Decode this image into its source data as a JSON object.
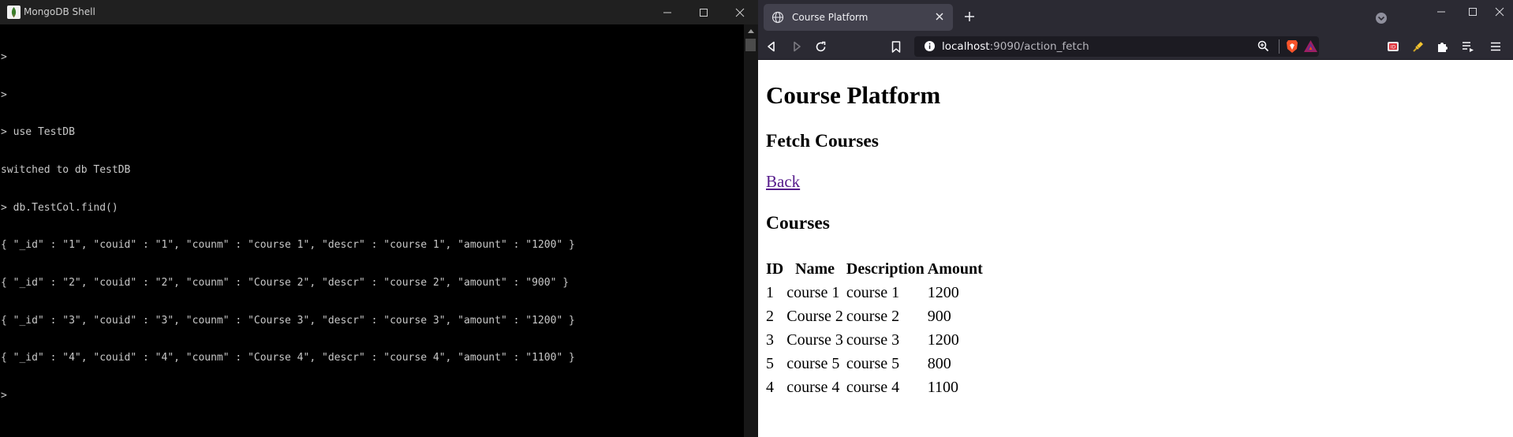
{
  "terminal": {
    "title": "MongoDB Shell",
    "lines": [
      ">",
      ">",
      "> use TestDB",
      "switched to db TestDB",
      "> db.TestCol.find()",
      "{ \"_id\" : \"1\", \"couid\" : \"1\", \"counm\" : \"course 1\", \"descr\" : \"course 1\", \"amount\" : \"1200\" }",
      "{ \"_id\" : \"2\", \"couid\" : \"2\", \"counm\" : \"Course 2\", \"descr\" : \"course 2\", \"amount\" : \"900\" }",
      "{ \"_id\" : \"3\", \"couid\" : \"3\", \"counm\" : \"Course 3\", \"descr\" : \"course 3\", \"amount\" : \"1200\" }",
      "{ \"_id\" : \"4\", \"couid\" : \"4\", \"counm\" : \"Course 4\", \"descr\" : \"course 4\", \"amount\" : \"1100\" }",
      ">"
    ]
  },
  "browser": {
    "tab": {
      "title": "Course Platform"
    },
    "url": {
      "host": "localhost",
      "rest": ":9090/action_fetch"
    }
  },
  "page": {
    "title": "Course Platform",
    "subtitle": "Fetch Courses",
    "back_link": "Back",
    "courses_heading": "Courses",
    "table": {
      "headers": [
        "ID",
        "Name",
        "Description",
        "Amount"
      ],
      "rows": [
        [
          "1",
          "course 1",
          "course 1",
          "1200"
        ],
        [
          "2",
          "Course 2",
          "course 2",
          "900"
        ],
        [
          "3",
          "Course 3",
          "course 3",
          "1200"
        ],
        [
          "5",
          "course 5",
          "course 5",
          "800"
        ],
        [
          "4",
          "course 4",
          "course 4",
          "1100"
        ]
      ]
    }
  },
  "colors": {
    "terminal_bg": "#000000",
    "terminal_text": "#c8c8c8",
    "browser_chrome": "#2b2a33",
    "visited_link": "#551a8b"
  }
}
